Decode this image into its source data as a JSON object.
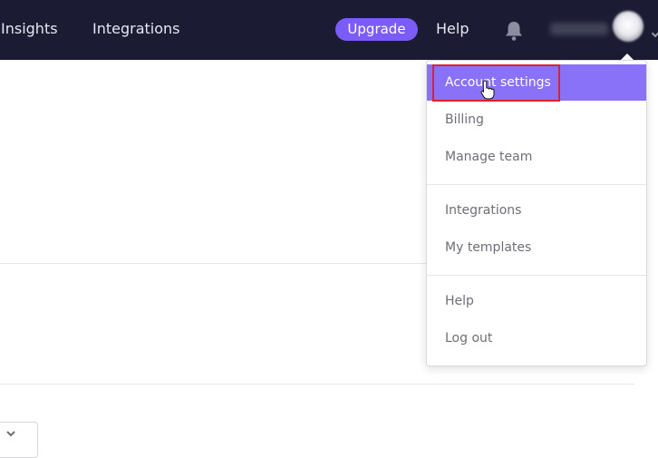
{
  "topbar": {
    "nav": [
      {
        "label": "Insights"
      },
      {
        "label": "Integrations"
      }
    ],
    "upgrade_label": "Upgrade",
    "help_label": "Help",
    "bell_icon": "bell-icon",
    "avatar_icon": "avatar"
  },
  "dropdown": {
    "groups": [
      [
        {
          "label": "Account settings",
          "active": true
        },
        {
          "label": "Billing"
        },
        {
          "label": "Manage team"
        }
      ],
      [
        {
          "label": "Integrations"
        },
        {
          "label": "My templates"
        }
      ],
      [
        {
          "label": "Help"
        },
        {
          "label": "Log out"
        }
      ]
    ]
  },
  "colors": {
    "topbar_bg": "#1b1c34",
    "accent": "#7b5cf6",
    "menu_active": "#8a72f8",
    "highlight": "#e0202a"
  }
}
